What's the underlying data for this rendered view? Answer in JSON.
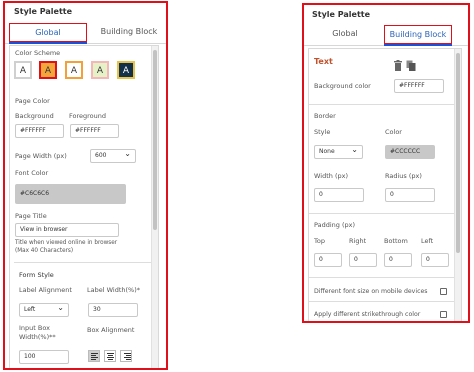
{
  "left": {
    "title": "Style Palette",
    "tabs": [
      "Global",
      "Building Block"
    ],
    "color_scheme_label": "Color Scheme",
    "swatches": [
      {
        "letter": "A",
        "bg": "#ffffff",
        "fg": "#333333",
        "border": "#d0d0d0"
      },
      {
        "letter": "A",
        "bg": "#f4a63a",
        "fg": "#333333",
        "border": "#e0101a"
      },
      {
        "letter": "A",
        "bg": "#ffffff",
        "fg": "#333333",
        "border": "#f2a13a"
      },
      {
        "letter": "A",
        "bg": "#e7f1c8",
        "fg": "#333333",
        "border": "#f4b6b6"
      },
      {
        "letter": "A",
        "bg": "#13324a",
        "fg": "#ffffff",
        "border": "#e7c34a"
      }
    ],
    "page_color_label": "Page Color",
    "background_label": "Background",
    "foreground_label": "Foreground",
    "background_value": "#FFFFFF",
    "foreground_value": "#FFFFFF",
    "page_width_label": "Page Width (px)",
    "page_width_value": "600",
    "font_color_label": "Font Color",
    "font_color_value": "#C6C6C6",
    "page_title_label": "Page Title",
    "page_title_value": "View in browser",
    "page_title_hint_1": "Title when viewed online in browser",
    "page_title_hint_2": "(Max 40 Characters)",
    "form_style_label": "Form Style",
    "label_alignment_label": "Label Alignment",
    "label_alignment_value": "Left",
    "label_width_label": "Label Width(%)*",
    "label_width_value": "30",
    "input_box_width_label_1": "Input Box",
    "input_box_width_label_2": "Width(%)**",
    "input_box_width_value": "100",
    "box_alignment_label": "Box Alignment",
    "box_alignment_selected": "left"
  },
  "right": {
    "title": "Style Palette",
    "tabs": [
      "Global",
      "Building Block"
    ],
    "section_title": "Text",
    "section_title_color": "#c0522d",
    "background_color_label": "Background color",
    "background_color_value": "#FFFFFF",
    "border_label": "Border",
    "style_label": "Style",
    "style_value": "None",
    "color_label": "Color",
    "color_value": "#CCCCCC",
    "width_label": "Width (px)",
    "width_value": "0",
    "radius_label": "Radius (px)",
    "radius_value": "0",
    "padding_label": "Padding (px)",
    "top_label": "Top",
    "right_label": "Right",
    "bottom_label": "Bottom",
    "left_label": "Left",
    "top_value": "0",
    "right_value": "0",
    "bottom_value": "0",
    "left_value": "0",
    "mobile_font_label": "Different font size on mobile devices",
    "mobile_font_checked": false,
    "strikethrough_label": "Apply different strikethrough color",
    "strikethrough_checked": false
  },
  "colors": {
    "highlight_border": "#e0101a",
    "active_tab_text": "#2b63b8",
    "active_tab_underline": "#1e4fd8"
  }
}
